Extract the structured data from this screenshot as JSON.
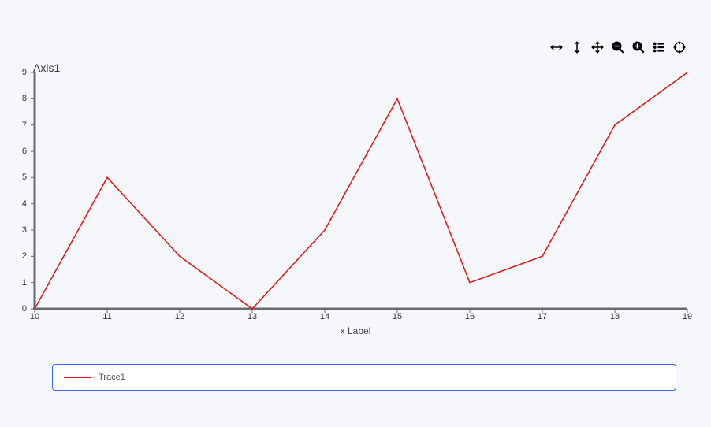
{
  "toolbar": {
    "tools": [
      {
        "name": "zoom-x-icon"
      },
      {
        "name": "zoom-y-icon"
      },
      {
        "name": "pan-icon"
      },
      {
        "name": "zoom-out-icon"
      },
      {
        "name": "zoom-in-icon"
      },
      {
        "name": "legend-toggle-icon"
      },
      {
        "name": "reset-icon"
      }
    ]
  },
  "chart_data": {
    "type": "line",
    "title": "",
    "xlabel": "x Label",
    "ylabel": "Axis1",
    "xlim": [
      10,
      19
    ],
    "ylim": [
      0,
      9
    ],
    "x_ticks": [
      10,
      11,
      12,
      13,
      14,
      15,
      16,
      17,
      18,
      19
    ],
    "y_ticks": [
      0,
      1,
      2,
      3,
      4,
      5,
      6,
      7,
      8,
      9
    ],
    "series": [
      {
        "name": "Trace1",
        "color": "#e31212",
        "x": [
          10,
          11,
          12,
          13,
          14,
          15,
          16,
          17,
          18,
          19
        ],
        "y": [
          0,
          5,
          2,
          0,
          3,
          8,
          1,
          2,
          7,
          9
        ]
      }
    ],
    "legend_position": "bottom"
  }
}
